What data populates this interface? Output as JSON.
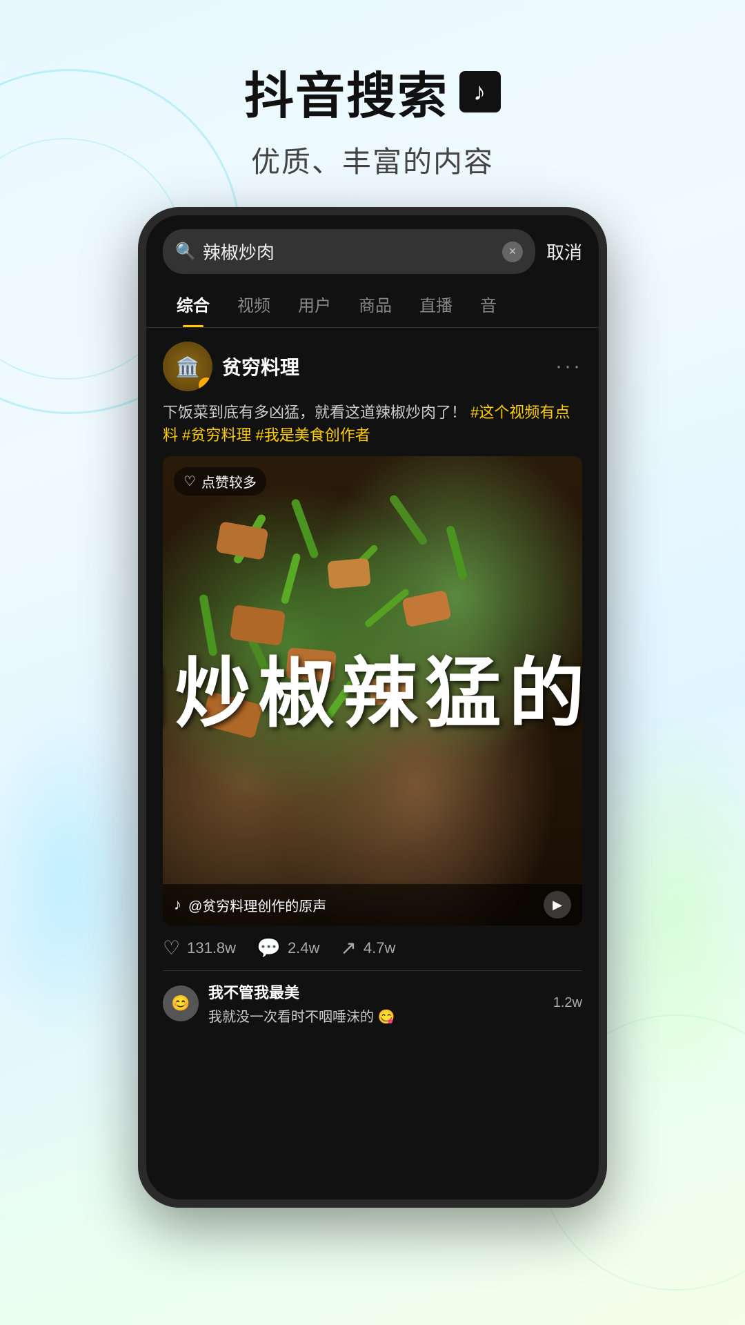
{
  "header": {
    "title": "抖音搜索",
    "logo_symbol": "♪",
    "subtitle": "优质、丰富的内容"
  },
  "phone": {
    "search": {
      "query": "辣椒炒肉",
      "placeholder": "辣椒炒肉",
      "cancel_label": "取消",
      "clear_icon": "×"
    },
    "tabs": [
      {
        "label": "综合",
        "active": true
      },
      {
        "label": "视频",
        "active": false
      },
      {
        "label": "用户",
        "active": false
      },
      {
        "label": "商品",
        "active": false
      },
      {
        "label": "直播",
        "active": false
      },
      {
        "label": "音",
        "active": false
      }
    ],
    "post": {
      "username": "贫穷料理",
      "avatar_emoji": "🏛️",
      "verified": true,
      "description": "下饭菜到底有多凶猛，就看这道辣椒炒肉了！",
      "hashtags": "#这个视频有点料 #贫穷料理 #我是美食创作者",
      "like_badge": "点赞较多",
      "video_text": "勇的猛辣椒炒肉",
      "audio_text": "@贫穷料理创作的原声",
      "stats": {
        "likes": "131.8w",
        "comments": "2.4w",
        "shares": "4.7w"
      },
      "comment": {
        "username": "我不管我最美",
        "text": "我就没一次看时不咽唾沫的 😋",
        "likes": "1.2w"
      }
    }
  }
}
